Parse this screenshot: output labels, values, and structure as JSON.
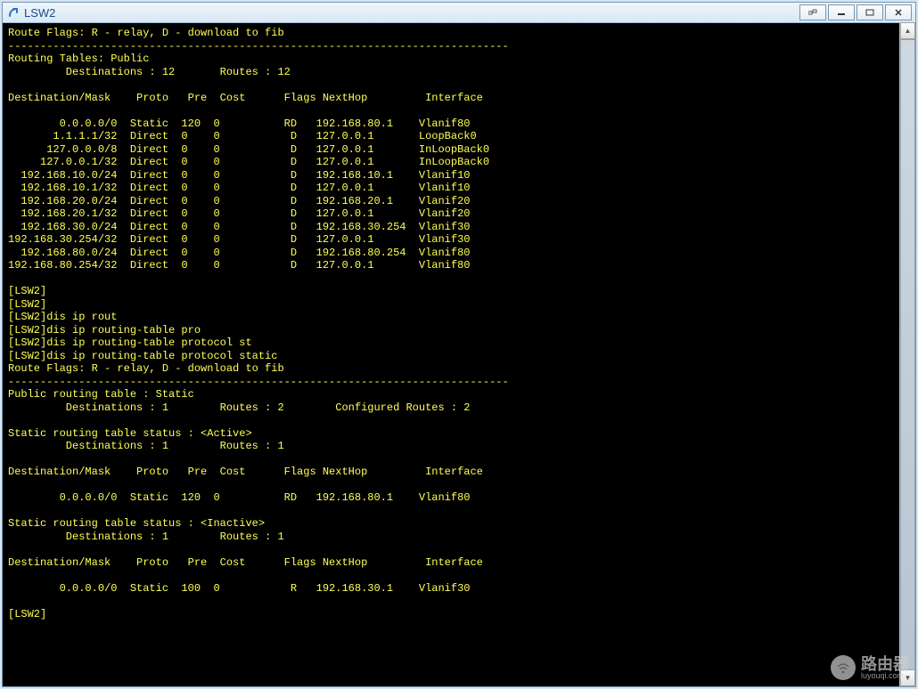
{
  "window": {
    "title": "LSW2"
  },
  "terminal": {
    "route_flags": "Route Flags: R - relay, D - download to fib",
    "divider": "------------------------------------------------------------------------------",
    "routing_tables_label": "Routing Tables: Public",
    "summary_line1": "         Destinations : 12       Routes : 12",
    "header": "Destination/Mask    Proto   Pre  Cost      Flags NextHop         Interface",
    "routes": [
      {
        "dest": "        0.0.0.0/0",
        "proto": "Static",
        "pre": "120",
        "cost": "0",
        "flags": "RD",
        "nexthop": "192.168.80.1",
        "iface": "Vlanif80"
      },
      {
        "dest": "       1.1.1.1/32",
        "proto": "Direct",
        "pre": "0",
        "cost": "0",
        "flags": "D",
        "nexthop": "127.0.0.1",
        "iface": "LoopBack0"
      },
      {
        "dest": "      127.0.0.0/8",
        "proto": "Direct",
        "pre": "0",
        "cost": "0",
        "flags": "D",
        "nexthop": "127.0.0.1",
        "iface": "InLoopBack0"
      },
      {
        "dest": "     127.0.0.1/32",
        "proto": "Direct",
        "pre": "0",
        "cost": "0",
        "flags": "D",
        "nexthop": "127.0.0.1",
        "iface": "InLoopBack0"
      },
      {
        "dest": "  192.168.10.0/24",
        "proto": "Direct",
        "pre": "0",
        "cost": "0",
        "flags": "D",
        "nexthop": "192.168.10.1",
        "iface": "Vlanif10"
      },
      {
        "dest": "  192.168.10.1/32",
        "proto": "Direct",
        "pre": "0",
        "cost": "0",
        "flags": "D",
        "nexthop": "127.0.0.1",
        "iface": "Vlanif10"
      },
      {
        "dest": "  192.168.20.0/24",
        "proto": "Direct",
        "pre": "0",
        "cost": "0",
        "flags": "D",
        "nexthop": "192.168.20.1",
        "iface": "Vlanif20"
      },
      {
        "dest": "  192.168.20.1/32",
        "proto": "Direct",
        "pre": "0",
        "cost": "0",
        "flags": "D",
        "nexthop": "127.0.0.1",
        "iface": "Vlanif20"
      },
      {
        "dest": "  192.168.30.0/24",
        "proto": "Direct",
        "pre": "0",
        "cost": "0",
        "flags": "D",
        "nexthop": "192.168.30.254",
        "iface": "Vlanif30"
      },
      {
        "dest": "192.168.30.254/32",
        "proto": "Direct",
        "pre": "0",
        "cost": "0",
        "flags": "D",
        "nexthop": "127.0.0.1",
        "iface": "Vlanif30"
      },
      {
        "dest": "  192.168.80.0/24",
        "proto": "Direct",
        "pre": "0",
        "cost": "0",
        "flags": "D",
        "nexthop": "192.168.80.254",
        "iface": "Vlanif80"
      },
      {
        "dest": "192.168.80.254/32",
        "proto": "Direct",
        "pre": "0",
        "cost": "0",
        "flags": "D",
        "nexthop": "127.0.0.1",
        "iface": "Vlanif80"
      }
    ],
    "prompts": [
      "[LSW2]",
      "[LSW2]",
      "[LSW2]dis ip rout",
      "[LSW2]dis ip routing-table pro",
      "[LSW2]dis ip routing-table protocol st",
      "[LSW2]dis ip routing-table protocol static"
    ],
    "route_flags2": "Route Flags: R - relay, D - download to fib",
    "public_static": "Public routing table : Static",
    "summary_line2": "         Destinations : 1        Routes : 2        Configured Routes : 2",
    "active_status": "Static routing table status : <Active>",
    "summary_line3": "         Destinations : 1        Routes : 1",
    "active_route": {
      "dest": "        0.0.0.0/0",
      "proto": "Static",
      "pre": "120",
      "cost": "0",
      "flags": "RD",
      "nexthop": "192.168.80.1",
      "iface": "Vlanif80"
    },
    "inactive_status": "Static routing table status : <Inactive>",
    "summary_line4": "         Destinations : 1        Routes : 1",
    "inactive_route": {
      "dest": "        0.0.0.0/0",
      "proto": "Static",
      "pre": "100",
      "cost": "0",
      "flags": "R",
      "nexthop": "192.168.30.1",
      "iface": "Vlanif30"
    },
    "final_prompt": "[LSW2]"
  },
  "watermark": {
    "big": "路由器",
    "small": "luyouqi.com"
  }
}
